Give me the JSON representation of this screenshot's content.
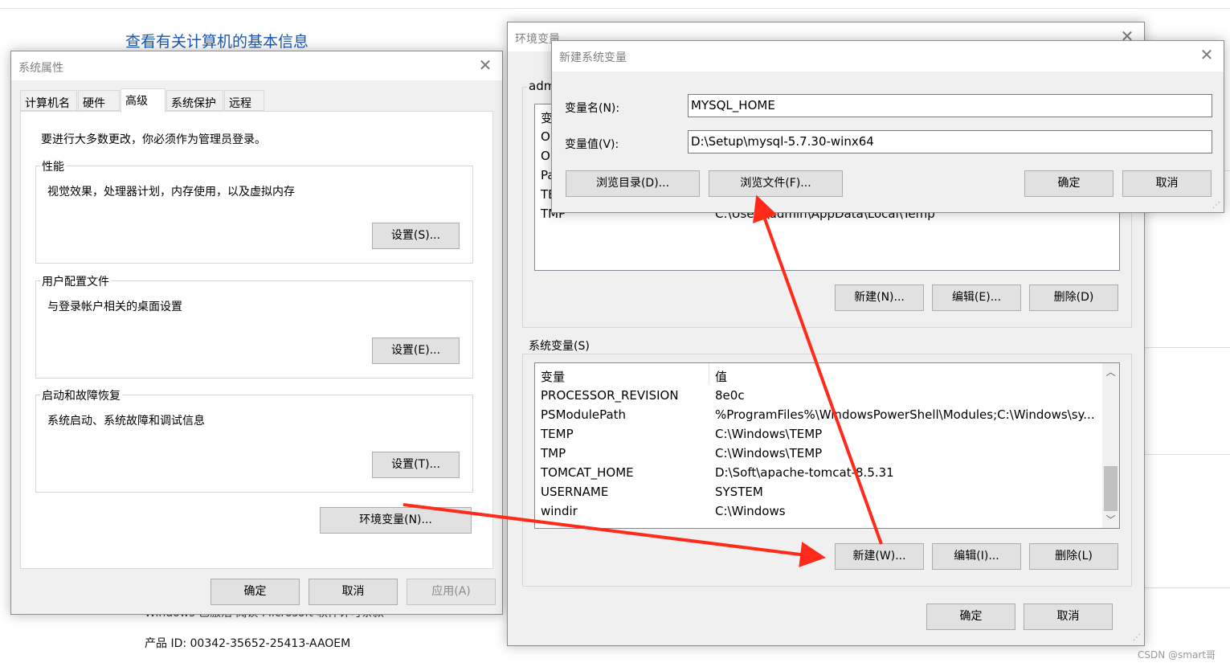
{
  "background": {
    "heading": "查看有关计算机的基本信息",
    "windows_line": "Windows 已激活 阅读 Microsoft 软件许可条款",
    "product_id": "产品 ID: 00342-35652-25413-AAOEM",
    "watermark": "CSDN @smart哥"
  },
  "sysprops": {
    "title": "系统属性",
    "tabs": [
      "计算机名",
      "硬件",
      "高级",
      "系统保护",
      "远程"
    ],
    "admin_note": "要进行大多数更改，你必须作为管理员登录。",
    "perf": {
      "label": "性能",
      "desc": "视觉效果，处理器计划，内存使用，以及虚拟内存",
      "button": "设置(S)..."
    },
    "profile": {
      "label": "用户配置文件",
      "desc": "与登录帐户相关的桌面设置",
      "button": "设置(E)..."
    },
    "startup": {
      "label": "启动和故障恢复",
      "desc": "系统启动、系统故障和调试信息",
      "button": "设置(T)..."
    },
    "env_button": "环境变量(N)...",
    "ok": "确定",
    "cancel": "取消",
    "apply": "应用(A)"
  },
  "envvars": {
    "title": "环境变量",
    "user_group_partial": "adm",
    "user_list_partial": {
      "header_partial": "变",
      "rows_partial": [
        "Or",
        "Or",
        "Pa",
        "TE"
      ],
      "tmp_name": "TMP",
      "tmp_value_partial": "C:\\Users\\admin\\AppData\\Local\\Temp"
    },
    "user_new": "新建(N)...",
    "user_edit": "编辑(E)...",
    "user_delete": "删除(D)",
    "sys_label": "系统变量(S)",
    "sys_header": {
      "name": "变量",
      "value": "值"
    },
    "sys_rows": [
      {
        "name": "PROCESSOR_REVISION",
        "value": "8e0c"
      },
      {
        "name": "PSModulePath",
        "value": "%ProgramFiles%\\WindowsPowerShell\\Modules;C:\\Windows\\sy..."
      },
      {
        "name": "TEMP",
        "value": "C:\\Windows\\TEMP"
      },
      {
        "name": "TMP",
        "value": "C:\\Windows\\TEMP"
      },
      {
        "name": "TOMCAT_HOME",
        "value": "D:\\Soft\\apache-tomcat-8.5.31"
      },
      {
        "name": "USERNAME",
        "value": "SYSTEM"
      },
      {
        "name": "windir",
        "value": "C:\\Windows"
      }
    ],
    "sys_new": "新建(W)...",
    "sys_edit": "编辑(I)...",
    "sys_delete": "删除(L)",
    "ok": "确定",
    "cancel": "取消"
  },
  "newvar": {
    "title": "新建系统变量",
    "name_label": "变量名(N):",
    "name_value": "MYSQL_HOME",
    "value_label": "变量值(V):",
    "value_value": "D:\\Setup\\mysql-5.7.30-winx64",
    "browse_dir": "浏览目录(D)...",
    "browse_file": "浏览文件(F)...",
    "ok": "确定",
    "cancel": "取消"
  },
  "colors": {
    "arrow": "#ff2a1a",
    "link": "#1a56b0",
    "dialog_bg": "#f0f0f0"
  }
}
